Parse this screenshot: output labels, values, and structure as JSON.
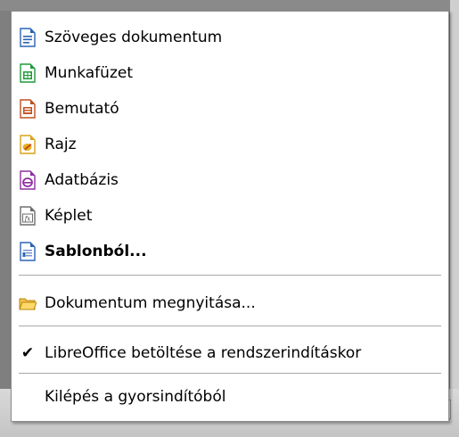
{
  "menu": {
    "items": [
      {
        "label": "Szöveges dokumentum",
        "icon": "writer-document-icon",
        "color": "#2a63b5"
      },
      {
        "label": "Munkafüzet",
        "icon": "calc-spreadsheet-icon",
        "color": "#1f9a3a"
      },
      {
        "label": "Bemutató",
        "icon": "impress-presentation-icon",
        "color": "#c0501e"
      },
      {
        "label": "Rajz",
        "icon": "draw-drawing-icon",
        "color": "#d9a21a"
      },
      {
        "label": "Adatbázis",
        "icon": "base-database-icon",
        "color": "#8e2ea0"
      },
      {
        "label": "Képlet",
        "icon": "math-formula-icon",
        "color": "#6e6e6e"
      },
      {
        "label": "Sablonból...",
        "icon": "template-icon",
        "color": "#2a63b5"
      }
    ],
    "open_label": "Dokumentum megnyitása...",
    "open_icon": "folder-icon",
    "load_label": "LibreOffice betöltése a rendszerindításkor",
    "load_checked": true,
    "exit_label": "Kilépés a gyorsindítóból"
  }
}
